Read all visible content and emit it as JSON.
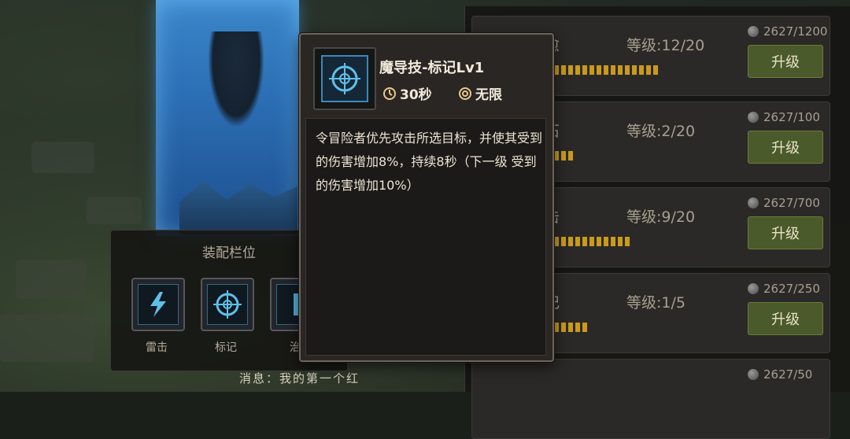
{
  "loadout": {
    "title": "装配栏位",
    "slots": [
      {
        "label": "雷击",
        "icon": "lightning-icon"
      },
      {
        "label": "标记",
        "icon": "crosshair-icon"
      },
      {
        "label": "治",
        "icon": "heal-icon"
      }
    ]
  },
  "chat": {
    "text": "消息：我的第一个红"
  },
  "skills": [
    {
      "name_fragment": "愈",
      "level": "等级:12/20",
      "progress": 0.6,
      "cost": "2627/1200",
      "button": "升级"
    },
    {
      "name_fragment": "石",
      "level": "等级:2/20",
      "progress": 0.1,
      "cost": "2627/100",
      "button": "升级"
    },
    {
      "name_fragment": "击",
      "level": "等级:9/20",
      "progress": 0.45,
      "cost": "2627/700",
      "button": "升级"
    },
    {
      "name_fragment": "记",
      "level": "等级:1/5",
      "progress": 0.2,
      "cost": "2627/250",
      "button": "升级"
    },
    {
      "name_fragment": "",
      "level": "",
      "progress": 0,
      "cost": "2627/50",
      "button": ""
    }
  ],
  "tooltip": {
    "title": "魔导技-标记Lv1",
    "cooldown": "30秒",
    "range": "无限",
    "description": "令冒险者优先攻击所选目标，并使其受到的伤害增加8%，持续8秒（下一级 受到的伤害增加10%）",
    "icon": "crosshair-icon"
  },
  "colors": {
    "accent_gold": "#c99a1b",
    "button_green": "#4a5a2a",
    "icon_blue": "#3a88b8"
  }
}
